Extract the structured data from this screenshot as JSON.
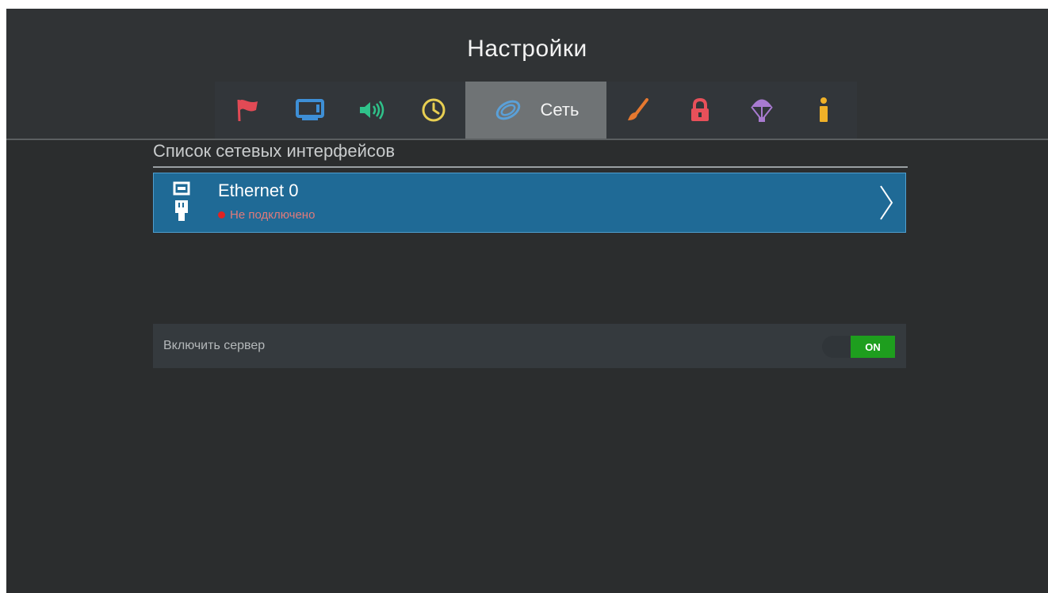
{
  "header": {
    "title": "Настройки"
  },
  "tabs": [
    {
      "icon": "flag-icon",
      "color": "#e24a55"
    },
    {
      "icon": "tv-screen-icon",
      "color": "#3e8fd6"
    },
    {
      "icon": "speaker-icon",
      "color": "#2fc28a"
    },
    {
      "icon": "clock-icon",
      "color": "#e8cf52"
    },
    {
      "icon": "network-icon",
      "color": "#5aa0d8",
      "label": "Сеть",
      "active": true
    },
    {
      "icon": "brush-icon",
      "color": "#e6782f"
    },
    {
      "icon": "lock-icon",
      "color": "#e8505a"
    },
    {
      "icon": "parachute-icon",
      "color": "#a87ad0"
    },
    {
      "icon": "info-icon",
      "color": "#f0b128"
    }
  ],
  "section": {
    "title": "Список сетевых интерфейсов"
  },
  "interfaces": [
    {
      "name": "Ethernet 0",
      "status": "Не подключено",
      "status_color": "#e02323",
      "icon": "ethernet-plug-icon"
    }
  ],
  "server": {
    "label": "Включить сервер",
    "toggle_state": "ON",
    "toggle_color": "#1e9e1e"
  }
}
